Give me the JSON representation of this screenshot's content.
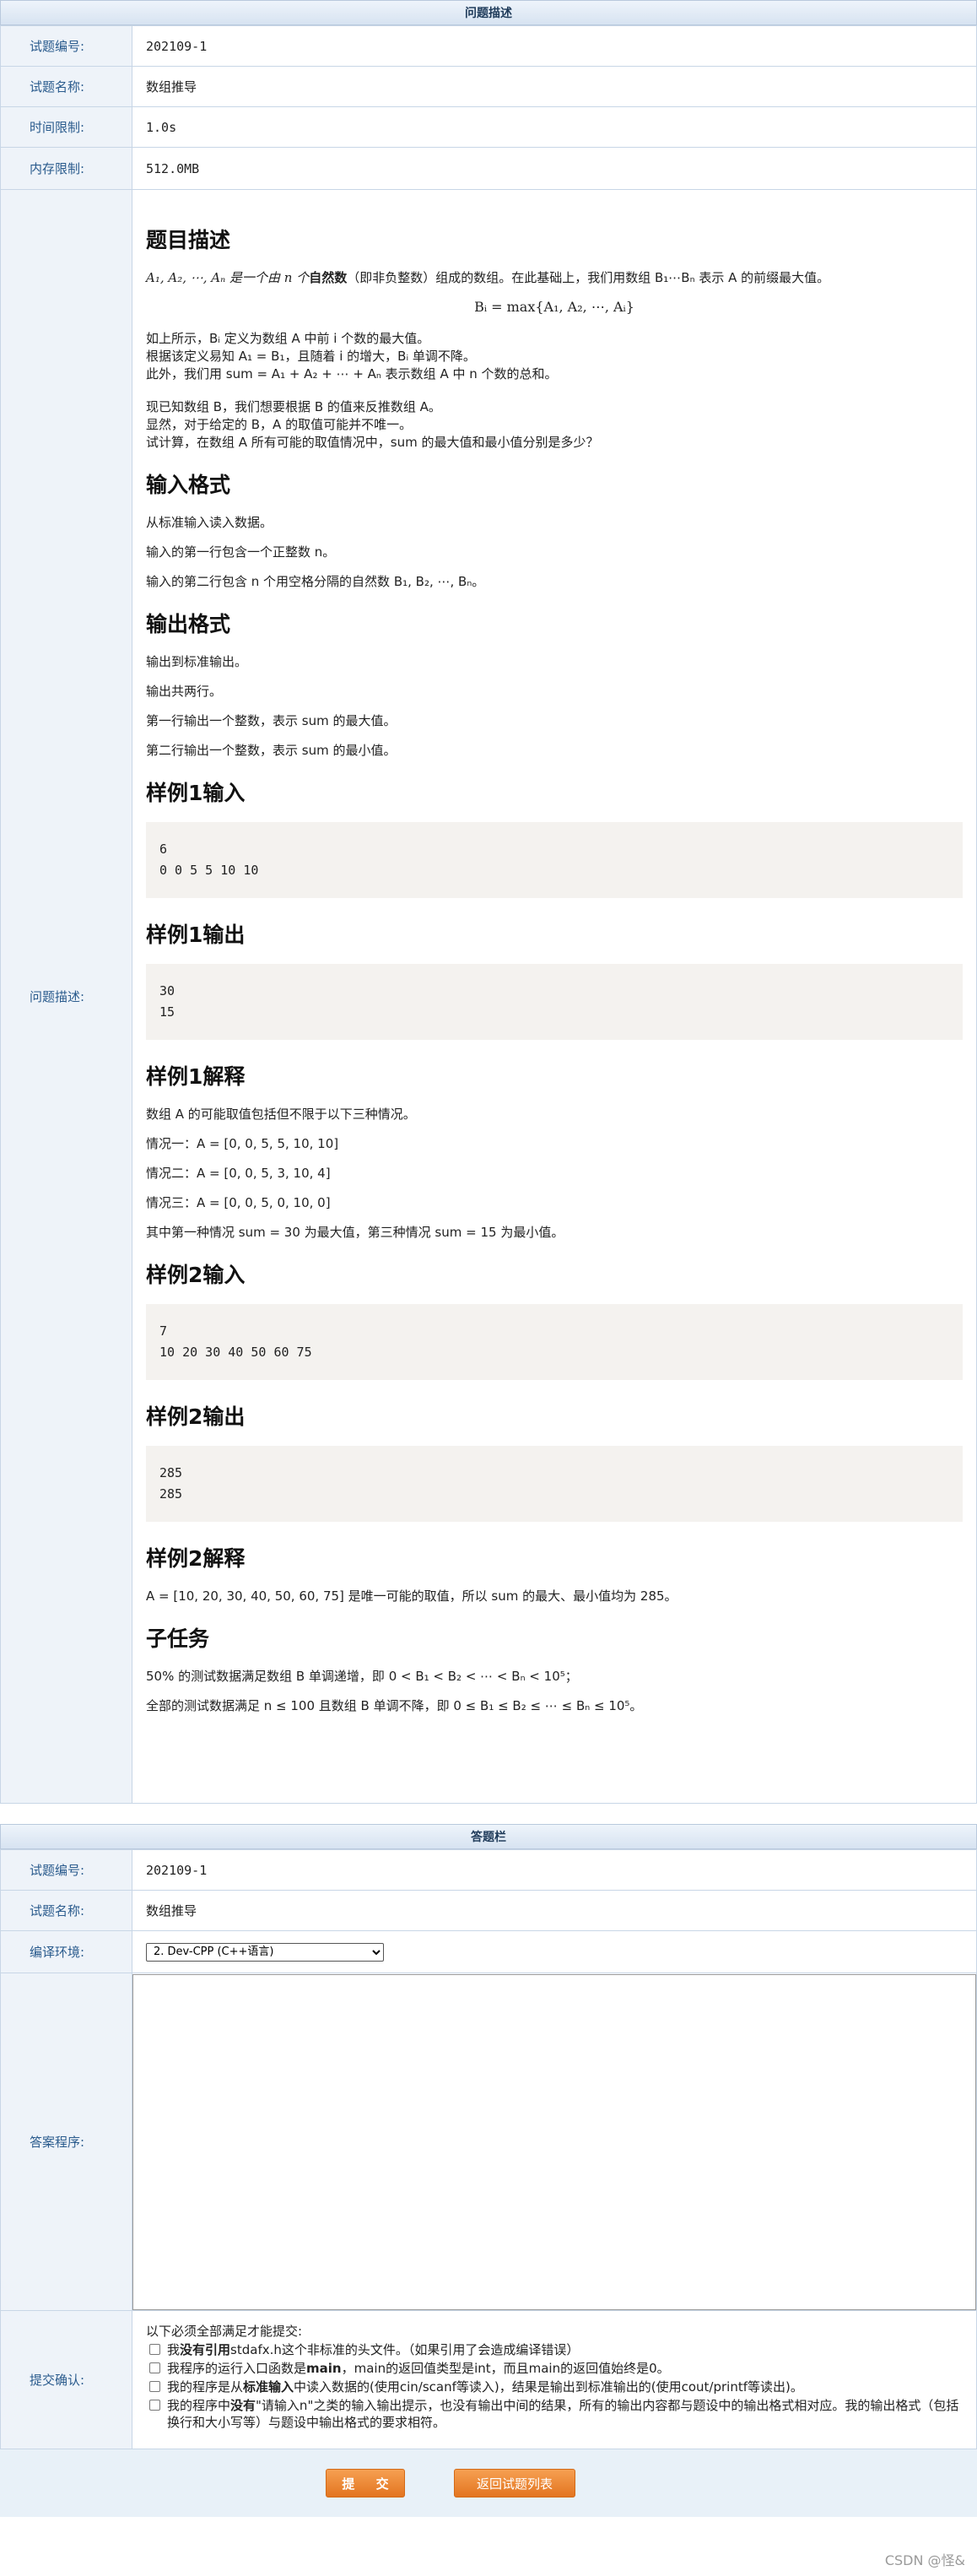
{
  "problem_panel": {
    "title": "问题描述",
    "rows": [
      {
        "label": "试题编号:",
        "value": "202109-1"
      },
      {
        "label": "试题名称:",
        "value": "数组推导"
      },
      {
        "label": "时间限制:",
        "value": "1.0s"
      },
      {
        "label": "内存限制:",
        "value": "512.0MB"
      }
    ],
    "desc_label": "问题描述:"
  },
  "statement": {
    "h_desc": "题目描述",
    "desc_p1a": "A₁, A₂, ⋯, Aₙ 是一个由 n 个",
    "desc_p1_bold": "自然数",
    "desc_p1b": "（即非负整数）组成的数组。在此基础上，我们用数组 B₁⋯Bₙ 表示 A 的前缀最大值。",
    "formula": "Bᵢ = max{A₁, A₂, ⋯, Aᵢ}",
    "desc_p2": "如上所示，Bᵢ 定义为数组 A 中前 i 个数的最大值。",
    "desc_p3": "根据该定义易知 A₁ = B₁，且随着 i 的增大，Bᵢ 单调不降。",
    "desc_p4": "此外，我们用 sum = A₁ + A₂ + ⋯ + Aₙ 表示数组 A 中 n 个数的总和。",
    "desc_p5": "现已知数组 B，我们想要根据 B 的值来反推数组 A。",
    "desc_p6": "显然，对于给定的 B，A 的取值可能并不唯一。",
    "desc_p7": "试计算，在数组 A 所有可能的取值情况中，sum 的最大值和最小值分别是多少？",
    "h_input": "输入格式",
    "input_p1": "从标准输入读入数据。",
    "input_p2": "输入的第一行包含一个正整数 n。",
    "input_p3": "输入的第二行包含 n 个用空格分隔的自然数 B₁, B₂, ⋯, Bₙ。",
    "h_output": "输出格式",
    "output_p1": "输出到标准输出。",
    "output_p2": "输出共两行。",
    "output_p3": "第一行输出一个整数，表示 sum 的最大值。",
    "output_p4": "第二行输出一个整数，表示 sum 的最小值。",
    "h_s1_in": "样例1输入",
    "s1_in": "6\n0 0 5 5 10 10",
    "h_s1_out": "样例1输出",
    "s1_out": "30\n15",
    "h_s1_exp": "样例1解释",
    "s1_exp_p1": "数组 A 的可能取值包括但不限于以下三种情况。",
    "s1_exp_p2": "情况一：A = [0, 0, 5, 5, 10, 10]",
    "s1_exp_p3": "情况二：A = [0, 0, 5, 3, 10, 4]",
    "s1_exp_p4": "情况三：A = [0, 0, 5, 0, 10, 0]",
    "s1_exp_p5": "其中第一种情况 sum = 30 为最大值，第三种情况 sum = 15 为最小值。",
    "h_s2_in": "样例2输入",
    "s2_in": "7\n10 20 30 40 50 60 75",
    "h_s2_out": "样例2输出",
    "s2_out": "285\n285",
    "h_s2_exp": "样例2解释",
    "s2_exp_p1": "A = [10, 20, 30, 40, 50, 60, 75] 是唯一可能的取值，所以 sum 的最大、最小值均为 285。",
    "h_sub": "子任务",
    "sub_p1": "50% 的测试数据满足数组 B 单调递增，即 0 < B₁ < B₂ < ⋯ < Bₙ < 10⁵；",
    "sub_p2": "全部的测试数据满足 n ≤ 100 且数组 B 单调不降，即 0 ≤ B₁ ≤ B₂ ≤ ⋯ ≤ Bₙ ≤ 10⁵。"
  },
  "answer_panel": {
    "title": "答题栏",
    "rows": [
      {
        "label": "试题编号:",
        "value": "202109-1"
      },
      {
        "label": "试题名称:",
        "value": "数组推导"
      }
    ],
    "compiler_label": "编译环境:",
    "compiler_value": "2. Dev-CPP (C++语言)",
    "code_label": "答案程序:",
    "code_value": "",
    "confirm_label": "提交确认:",
    "confirm_intro": "以下必须全部满足才能提交:",
    "confirm_items": [
      {
        "a": "我",
        "b": "没有引用",
        "c": "stdafx.h这个非标准的头文件。（如果引用了会造成编译错误）"
      },
      {
        "a": "我程序的运行入口函数是",
        "b": "main",
        "c": "，main的返回值类型是int，而且main的返回值始终是0。"
      },
      {
        "a": "我的程序是从",
        "b": "标准输入",
        "c": "中读入数据的(使用cin/scanf等读入)，结果是输出到标准输出的(使用cout/printf等读出)。"
      },
      {
        "a": "我的程序中",
        "b": "没有",
        "c": "\"请输入n\"之类的输入输出提示，也没有输出中间的结果，所有的输出内容都与题设中的输出格式相对应。我的输出格式（包括换行和大小写等）与题设中输出格式的要求相符。"
      }
    ]
  },
  "buttons": {
    "submit": "提 交",
    "back": "返回试题列表"
  },
  "watermark": "CSDN @怪&"
}
